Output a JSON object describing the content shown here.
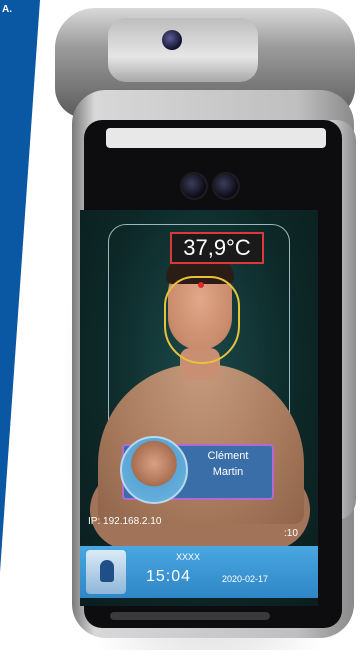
{
  "corner_text": "A.",
  "screen": {
    "temperature": "37,9°C",
    "identity": {
      "first_name": "Clément",
      "last_name": "Martin"
    },
    "ip_label": "IP: 192.168.2.10",
    "right_time": ":10",
    "bottom_bar": {
      "placeholder": "XXXX",
      "time": "15:04",
      "date": "2020-02-17"
    }
  },
  "colors": {
    "temp_border": "#d83a3a",
    "card_border": "#b568d1",
    "bar_blue": "#3a8fd0",
    "stripe_blue": "#0a57a4"
  }
}
